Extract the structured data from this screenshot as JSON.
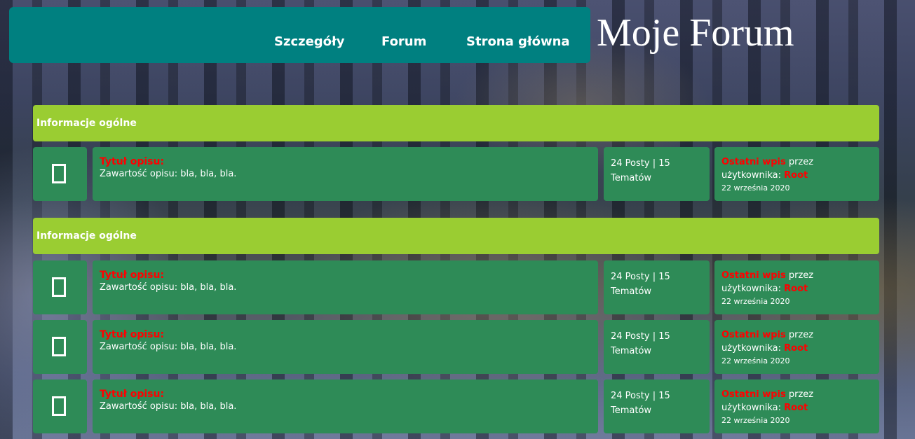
{
  "header": {
    "nav": [
      "Szczegóły",
      "Forum",
      "Strona główna"
    ],
    "site_title": "Moje Forum"
  },
  "sections": [
    {
      "label": "Informacje ogólne",
      "rows": [
        {
          "icon": "forum-icon",
          "title": "Tytuł opisu:",
          "content": "Zawartość opisu: bla, bla, bla.",
          "stats": "24 Posty | 15 Tematów",
          "last_label": "Ostatni wpis",
          "last_by": "przez użytkownika:",
          "last_user": "Root",
          "last_date": "22 września 2020"
        }
      ]
    },
    {
      "label": "Informacje ogólne",
      "rows": [
        {
          "icon": "forum-icon",
          "title": "Tytuł opisu:",
          "content": "Zawartość opisu: bla, bla, bla.",
          "stats": "24 Posty | 15 Tematów",
          "last_label": "Ostatni wpis",
          "last_by": "przez użytkownika:",
          "last_user": "Root",
          "last_date": "22 września 2020"
        },
        {
          "icon": "forum-icon",
          "title": "Tytuł opisu:",
          "content": "Zawartość opisu: bla, bla, bla.",
          "stats": "24 Posty | 15 Tematów",
          "last_label": "Ostatni wpis",
          "last_by": "przez użytkownika:",
          "last_user": "Root",
          "last_date": "22 września 2020"
        },
        {
          "icon": "forum-icon",
          "title": "Tytuł opisu:",
          "content": "Zawartość opisu: bla, bla, bla.",
          "stats": "24 Posty | 15 Tematów",
          "last_label": "Ostatni wpis",
          "last_by": "przez użytkownika:",
          "last_user": "Root",
          "last_date": "22 września 2020"
        }
      ]
    }
  ]
}
